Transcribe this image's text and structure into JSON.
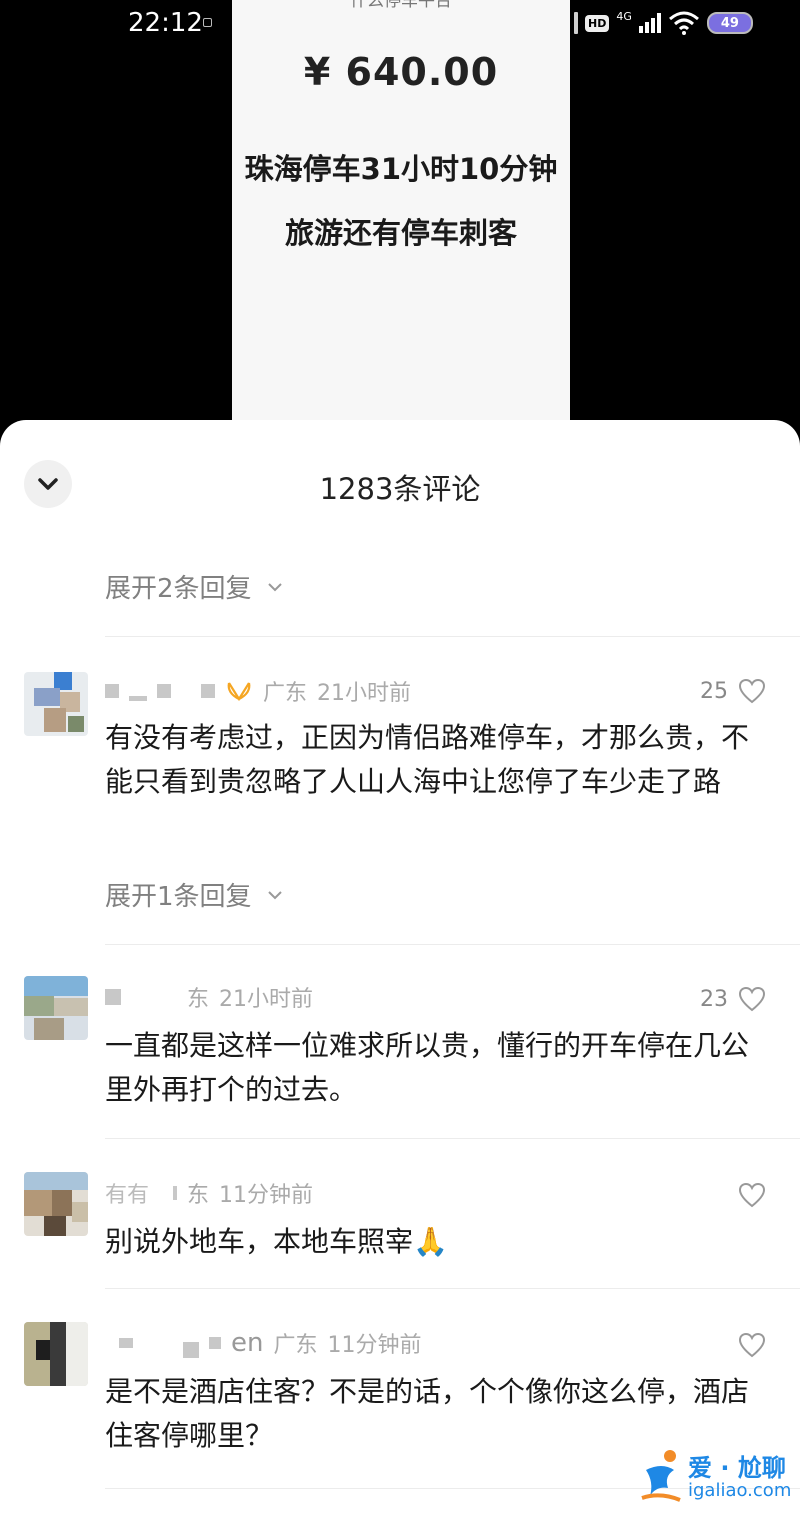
{
  "status_bar": {
    "time": "22:12",
    "network_badge": "HD",
    "network_type": "4G",
    "battery": "49",
    "icons": [
      "notification-icon",
      "hd-icon",
      "signal-icon",
      "wifi-icon",
      "battery-icon"
    ]
  },
  "video": {
    "cut_text": "什么停车平台",
    "price": "¥ 640.00",
    "line1": "珠海停车31小时10分钟",
    "line2": "旅游还有停车刺客"
  },
  "comments_header": {
    "title": "1283条评论",
    "collapse_icon": "chevron-down-icon"
  },
  "top_expand": "展开2条回复",
  "comments": [
    {
      "name_suffix": "",
      "badge_icon": "couple-badge-icon",
      "region": "广东",
      "time": "21小时前",
      "likes": "25",
      "text": "有没有考虑过，正因为情侣路难停车，才那么贵，不能只看到贵忽略了人山人海中让您停了车少走了路",
      "expand": "展开1条回复"
    },
    {
      "name_suffix": "",
      "region": "东",
      "time": "21小时前",
      "likes": "23",
      "text": "一直都是这样一位难求所以贵，懂行的开车停在几公里外再打个的过去。"
    },
    {
      "name_suffix": "有有",
      "region": "东",
      "time": "11分钟前",
      "likes": "",
      "text": "别说外地车，本地车照宰🙏"
    },
    {
      "name_suffix": "en",
      "region": "广东",
      "time": "11分钟前",
      "likes": "",
      "text": "是不是酒店住客？不是的话，个个像你这么停，酒店住客停哪里？"
    }
  ],
  "watermark": {
    "top": "爱 · 尬聊",
    "bottom": "igaliao.com"
  },
  "colors": {
    "sheet_bg": "#ffffff",
    "meta_gray": "#aaaaaa",
    "battery_purple": "#7b6fe0",
    "watermark_blue": "#1e88e5"
  }
}
